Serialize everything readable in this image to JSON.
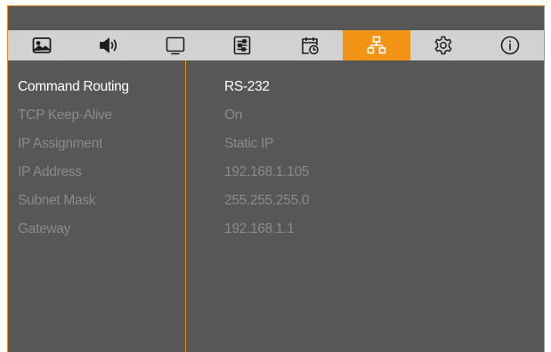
{
  "tabs": [
    {
      "icon": "image-icon",
      "active": false
    },
    {
      "icon": "speaker-icon",
      "active": false
    },
    {
      "icon": "display-icon",
      "active": false
    },
    {
      "icon": "sliders-icon",
      "active": false
    },
    {
      "icon": "schedule-icon",
      "active": false
    },
    {
      "icon": "network-icon",
      "active": true
    },
    {
      "icon": "settings-gear-icon",
      "active": false
    },
    {
      "icon": "info-icon",
      "active": false
    }
  ],
  "settings": [
    {
      "label": "Command Routing",
      "value": "RS-232"
    },
    {
      "label": "TCP Keep-Alive",
      "value": "On"
    },
    {
      "label": "IP Assignment",
      "value": "Static IP"
    },
    {
      "label": "IP Address",
      "value": "192.168.1.105"
    },
    {
      "label": "Subnet Mask",
      "value": "255.255.255.0"
    },
    {
      "label": "Gateway",
      "value": "192.168.1.1"
    }
  ],
  "colors": {
    "accent": "#f29517",
    "panel_background": "#575757",
    "tab_bar_background": "#d2d2d2",
    "active_text": "#ffffff",
    "inactive_text": "#8a8a8a"
  }
}
